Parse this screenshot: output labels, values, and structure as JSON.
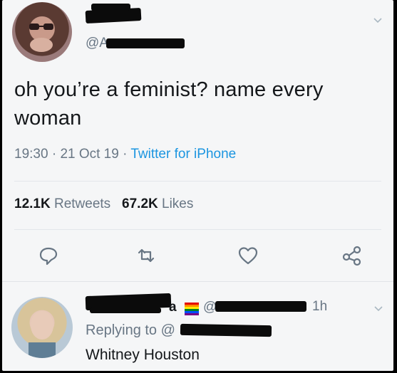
{
  "tweet": {
    "handle": "@A",
    "text": "oh you’re a feminist? name every woman",
    "time": "19:30",
    "date": "21 Oct 19",
    "source": "Twitter for iPhone",
    "retweets_count": "12.1K",
    "retweets_label": "Retweets",
    "likes_count": "67.2K",
    "likes_label": "Likes"
  },
  "reply": {
    "name_suffix": "a",
    "at_prefix": "@",
    "time": "1h",
    "replying_to": "Replying to @",
    "text": "Whitney Houston"
  },
  "icons": [
    "chevron-down-icon",
    "reply-icon",
    "retweet-icon",
    "like-icon",
    "share-icon",
    "pride-flag-icon"
  ],
  "colors": {
    "link": "#1b95e0",
    "muted": "#687684",
    "text": "#14171a"
  }
}
